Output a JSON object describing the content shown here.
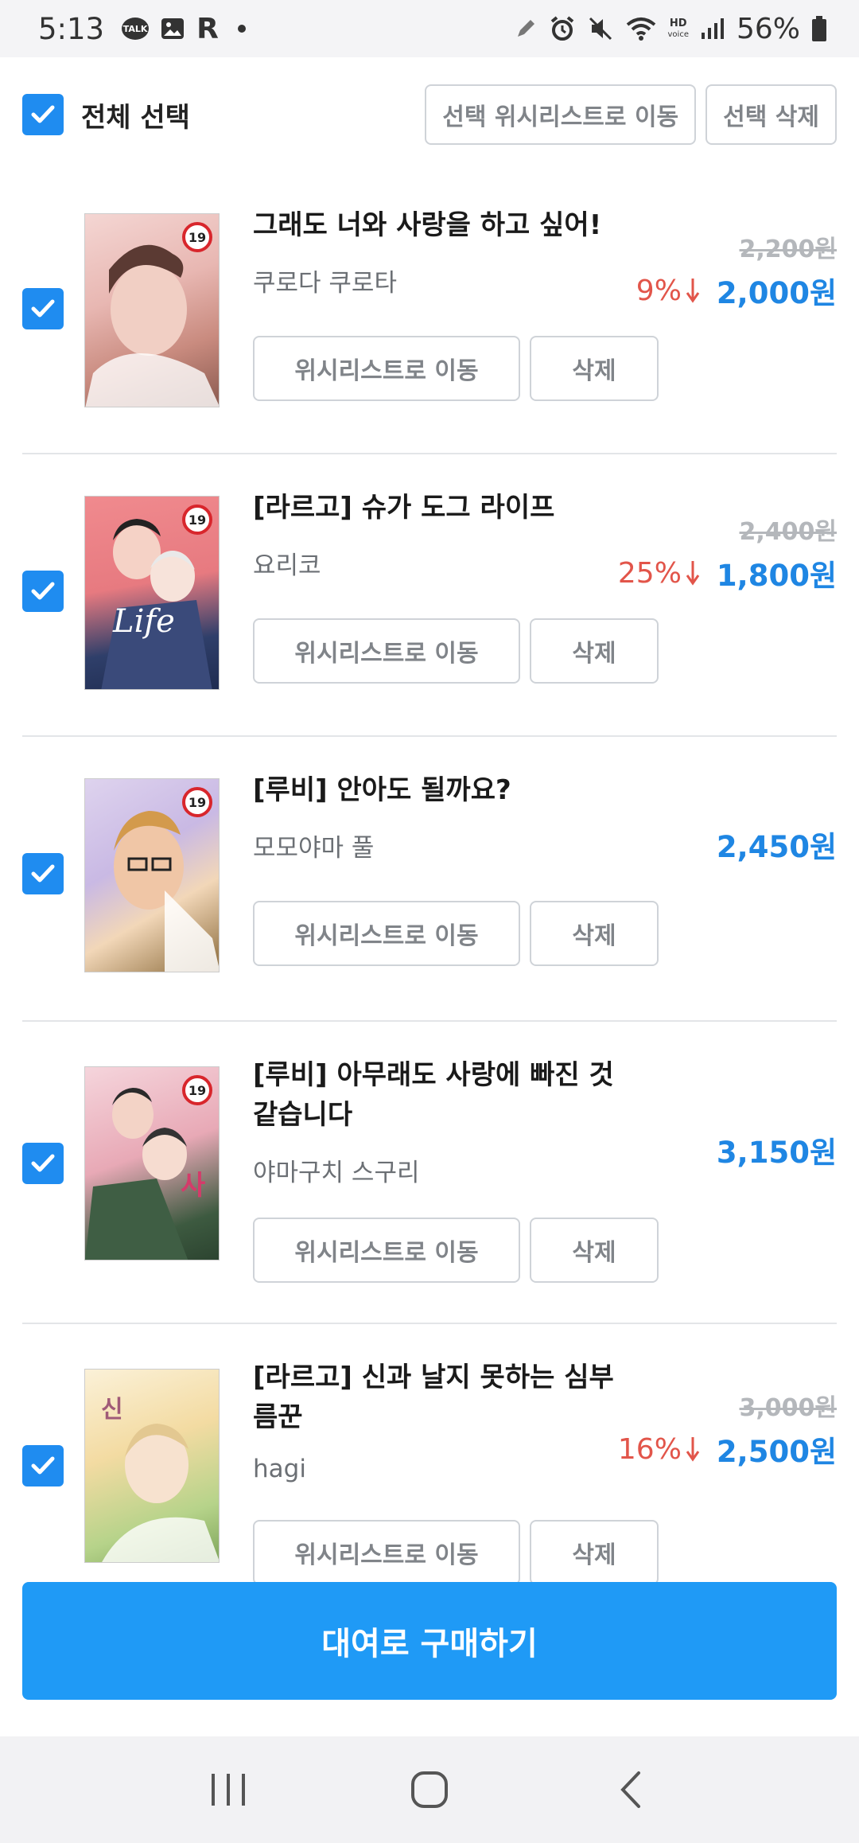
{
  "status_bar": {
    "time": "5:13",
    "talk_label": "TALK",
    "r_label": "R",
    "hd_label": "HD",
    "voice_label": "voice",
    "battery": "56%",
    "icons": [
      "talk-icon",
      "gallery-icon",
      "r-icon",
      "pen-icon",
      "alarm-icon",
      "mute-icon",
      "wifi-icon",
      "hd-voice-icon",
      "signal-icon",
      "battery-icon"
    ]
  },
  "header": {
    "select_all": "전체 선택",
    "move_selected_to_wishlist": "선택 위시리스트로 이동",
    "delete_selected": "선택 삭제"
  },
  "items": [
    {
      "title": "그래도 너와 사랑을 하고 싶어!",
      "author": "쿠로다 쿠로타",
      "original_price": "2,200원",
      "discount": "9%",
      "price": "2,000원",
      "badge": "19",
      "wishlist_label": "위시리스트로 이동",
      "delete_label": "삭제"
    },
    {
      "title": "[라르고] 슈가 도그 라이프",
      "author": "요리코",
      "original_price": "2,400원",
      "discount": "25%",
      "price": "1,800원",
      "badge": "19",
      "wishlist_label": "위시리스트로 이동",
      "delete_label": "삭제"
    },
    {
      "title": "[루비] 안아도 될까요?",
      "author": "모모야마 풀",
      "price": "2,450원",
      "badge": "19",
      "wishlist_label": "위시리스트로 이동",
      "delete_label": "삭제"
    },
    {
      "title": "[루비] 아무래도 사랑에 빠진 것 같습니다",
      "author": "야마구치 스구리",
      "price": "3,150원",
      "badge": "19",
      "wishlist_label": "위시리스트로 이동",
      "delete_label": "삭제"
    },
    {
      "title": "[라르고] 신과 날지 못하는 심부름꾼",
      "author": "hagi",
      "original_price": "3,000원",
      "discount": "16%",
      "price": "2,500원",
      "wishlist_label": "위시리스트로 이동",
      "delete_label": "삭제"
    }
  ],
  "buy_button": "대여로 구매하기",
  "colors": {
    "accent_blue": "#1f9af6",
    "price_blue": "#1f86e3",
    "discount_red": "#e2554a",
    "checkbox_blue": "#1f8cf0"
  }
}
